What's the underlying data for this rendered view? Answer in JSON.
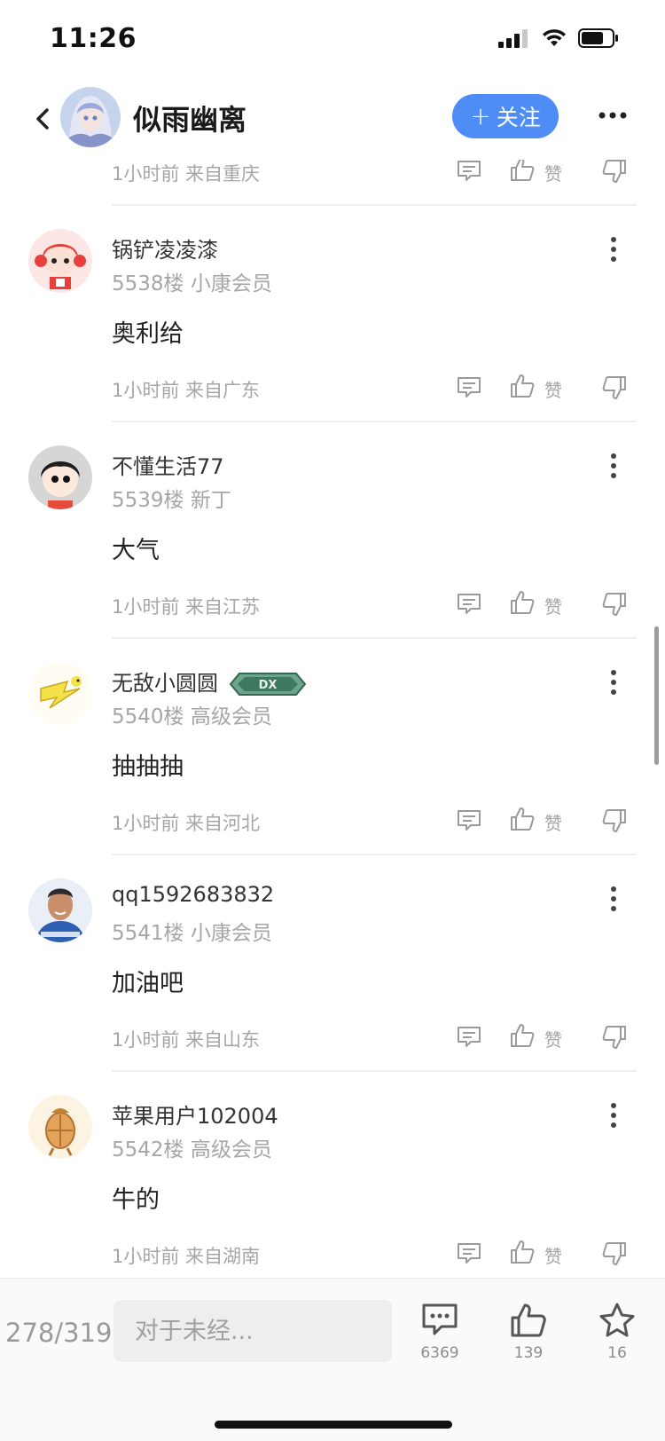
{
  "status_bar": {
    "time": "11:26"
  },
  "header": {
    "title": "似雨幽离",
    "follow_label": "关注"
  },
  "top_partial_comment": {
    "meta": "1小时前 来自重庆",
    "like_label": "赞"
  },
  "comments": [
    {
      "username": "锅铲凌凌漆",
      "floor": "5538楼 小康会员",
      "content": "奥利给",
      "meta": "1小时前 来自广东",
      "like_label": "赞"
    },
    {
      "username": "不懂生活77",
      "floor": "5539楼 新丁",
      "content": "大气",
      "meta": "1小时前 来自江苏",
      "like_label": "赞"
    },
    {
      "username": "无敌小圆圆",
      "floor": "5540楼 高级会员",
      "content": "抽抽抽",
      "meta": "1小时前 来自河北",
      "like_label": "赞",
      "badge": "DX"
    },
    {
      "username": "qq1592683832",
      "floor": "5541楼 小康会员",
      "content": "加油吧",
      "meta": "1小时前 来自山东",
      "like_label": "赞"
    },
    {
      "username": "苹果用户102004",
      "floor": "5542楼 高级会员",
      "content": "牛的",
      "meta": "1小时前 来自湖南",
      "like_label": "赞"
    }
  ],
  "bottom_bar": {
    "page_count": "278/319",
    "input_placeholder": "对于未经...",
    "comment_count": "6369",
    "like_count": "139",
    "favorite_count": "16"
  },
  "colors": {
    "accent": "#4e8cf6",
    "muted": "#a6a6a6",
    "divider": "#efefef"
  }
}
